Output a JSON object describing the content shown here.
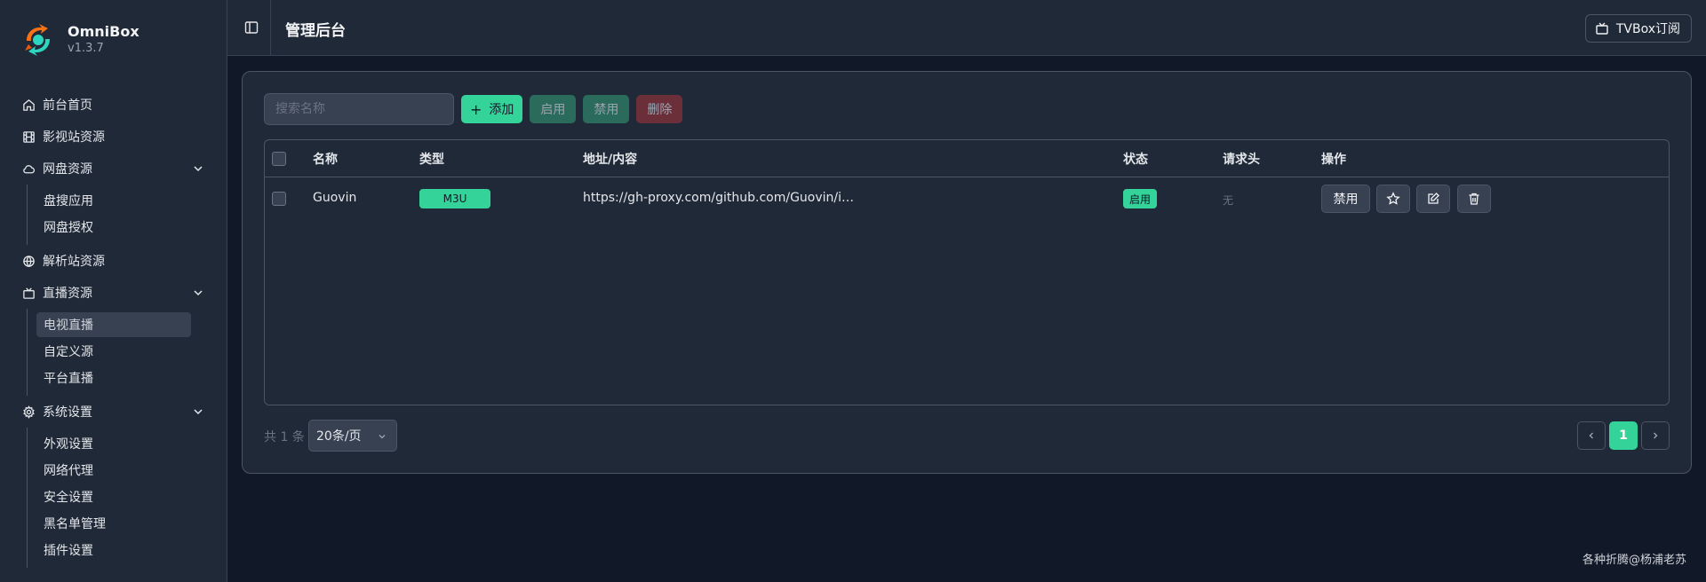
{
  "brand": {
    "name": "OmniBox",
    "version": "v1.3.7"
  },
  "sidebar": {
    "items": [
      {
        "label": "前台首页",
        "icon": "home-icon"
      },
      {
        "label": "影视站资源",
        "icon": "film-icon"
      },
      {
        "label": "网盘资源",
        "icon": "cloud-icon",
        "expanded": true,
        "children": [
          "盘搜应用",
          "网盘授权"
        ]
      },
      {
        "label": "解析站资源",
        "icon": "globe-icon"
      },
      {
        "label": "直播资源",
        "icon": "tv-icon",
        "expanded": true,
        "children": [
          "电视直播",
          "自定义源",
          "平台直播"
        ],
        "active_child": "电视直播"
      },
      {
        "label": "系统设置",
        "icon": "gear-icon",
        "expanded": true,
        "children": [
          "外观设置",
          "网络代理",
          "安全设置",
          "黑名单管理",
          "插件设置"
        ]
      }
    ]
  },
  "header": {
    "title": "管理后台",
    "tvbox_label": "TVBox订阅"
  },
  "toolbar": {
    "search_placeholder": "搜索名称",
    "add_label": "添加",
    "enable_label": "启用",
    "disable_label": "禁用",
    "delete_label": "删除"
  },
  "table": {
    "columns": [
      "名称",
      "类型",
      "地址/内容",
      "状态",
      "请求头",
      "操作"
    ],
    "rows": [
      {
        "name": "Guovin",
        "type": "M3U",
        "address": "https://gh-proxy.com/github.com/Guovin/i…",
        "status": "启用",
        "headers": "无",
        "action_label": "禁用"
      }
    ]
  },
  "pagination": {
    "total": "共 1 条",
    "page_size": "20条/页",
    "current_page": "1"
  },
  "watermark": "各种折腾@杨浦老苏",
  "colors": {
    "accent": "#34d399",
    "background": "#111827",
    "surface": "#1f2937",
    "border": "#4b5563"
  }
}
